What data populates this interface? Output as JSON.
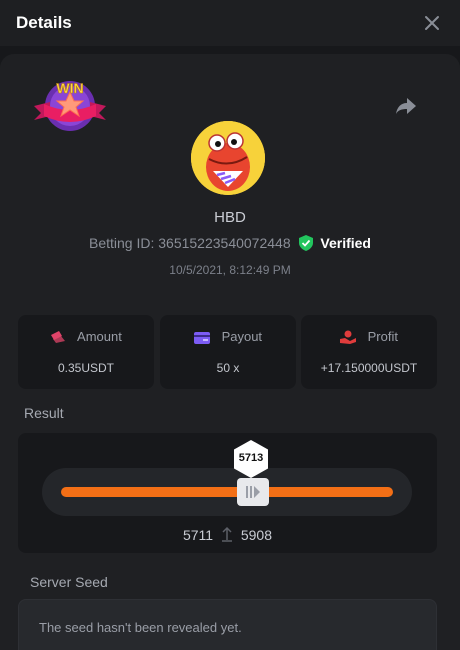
{
  "header": {
    "title": "Details"
  },
  "icons": {
    "close": "close-icon",
    "share": "share-icon",
    "win_badge": "win-badge-icon",
    "verified": "shield-check-icon",
    "amount": "amount-icon",
    "payout": "payout-card-icon",
    "profit": "profit-icon",
    "slider": "slider-thumb-icon",
    "range_separator": "arrow-up-icon"
  },
  "colors": {
    "accent": "#f36f16",
    "verified": "#22c55e",
    "amount_icon": "#e0446a",
    "payout_icon": "#7c5cf5",
    "profit_icon": "#e03c3c"
  },
  "bet": {
    "badge": "WIN",
    "username": "HBD",
    "betting_id_label": "Betting ID:",
    "betting_id": "36515223540072448",
    "verified_label": "Verified",
    "timestamp": "10/5/2021, 8:12:49 PM"
  },
  "stats": [
    {
      "label": "Amount",
      "value": "0.35USDT"
    },
    {
      "label": "Payout",
      "value": "50 x"
    },
    {
      "label": "Profit",
      "value": "+17.150000USDT"
    }
  ],
  "result": {
    "label": "Result",
    "value": "5713",
    "range_low": "5711",
    "range_high": "5908"
  },
  "server_seed": {
    "label": "Server Seed",
    "text": "The seed hasn't been revealed yet."
  }
}
